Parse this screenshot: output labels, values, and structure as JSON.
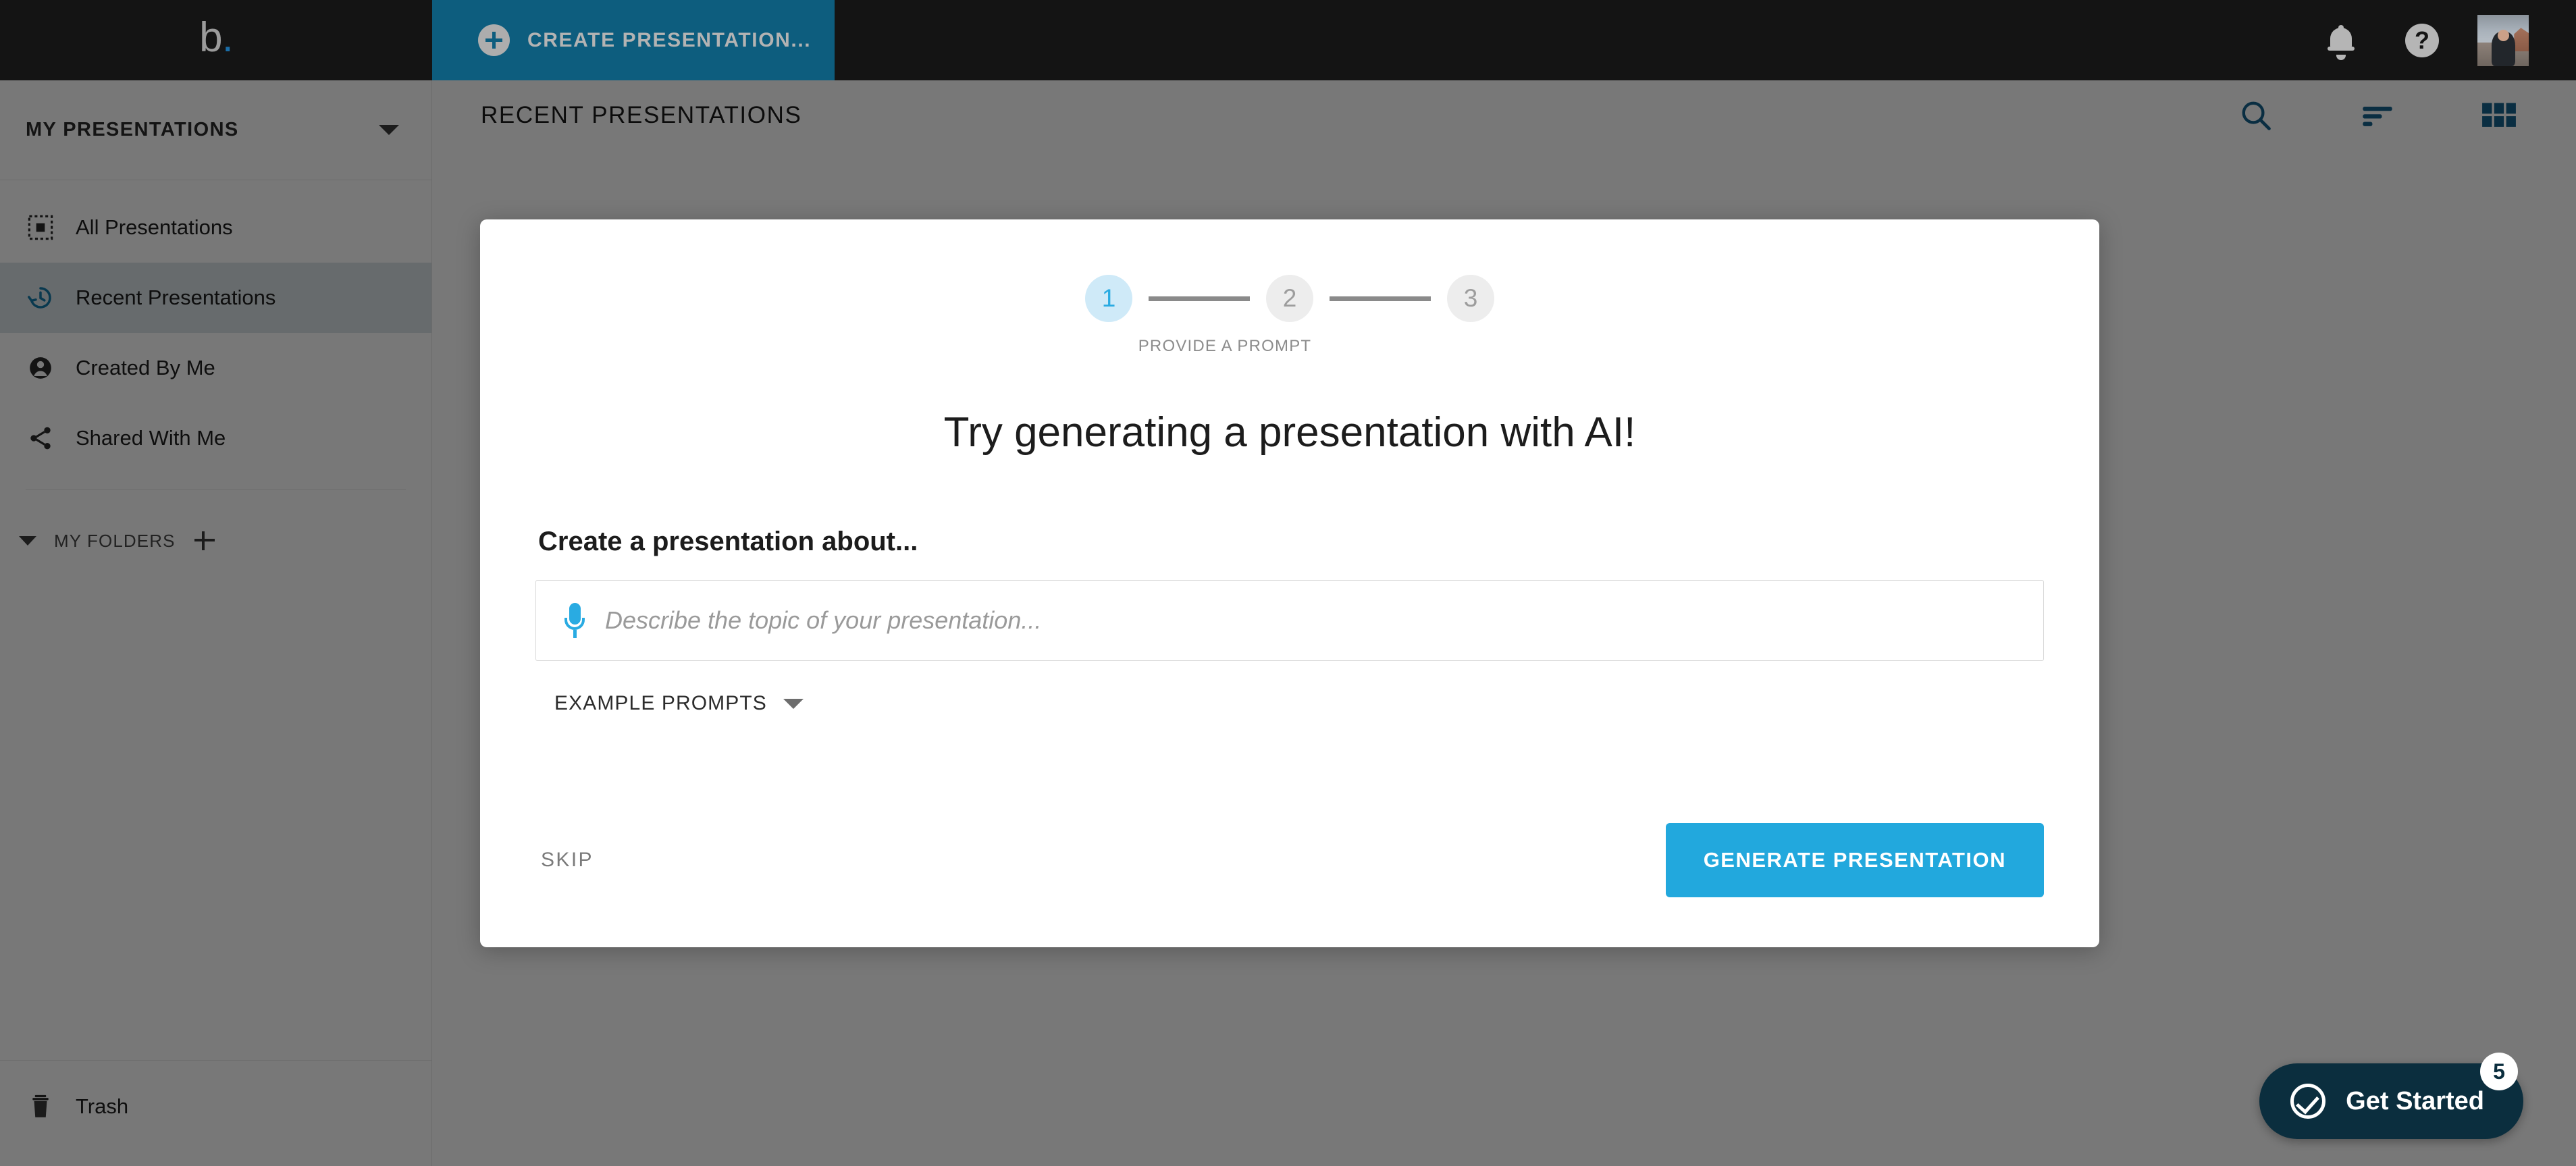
{
  "app": {
    "logo_text": "b",
    "logo_dot": "."
  },
  "topbar": {
    "create_button_label": "CREATE PRESENTATION...",
    "create_icon": "plus-circle-icon",
    "notifications_icon": "bell-icon",
    "help_icon": "help-circle-icon",
    "help_glyph": "?",
    "avatar_icon": "user-avatar"
  },
  "sidebar": {
    "header_title": "MY PRESENTATIONS",
    "header_caret_icon": "chevron-down-icon",
    "items": [
      {
        "label": "All Presentations",
        "icon": "dashed-square-icon",
        "active": false
      },
      {
        "label": "Recent Presentations",
        "icon": "history-clock-icon",
        "active": true
      },
      {
        "label": "Created By Me",
        "icon": "account-circle-icon",
        "active": false
      },
      {
        "label": "Shared With Me",
        "icon": "share-icon",
        "active": false
      }
    ],
    "folders": {
      "label": "MY FOLDERS",
      "caret_icon": "chevron-down-icon",
      "add_icon": "plus-icon"
    },
    "trash": {
      "label": "Trash",
      "icon": "trash-icon"
    }
  },
  "main": {
    "title": "RECENT PRESENTATIONS",
    "tools": [
      {
        "name": "search-icon"
      },
      {
        "name": "sort-icon"
      },
      {
        "name": "grid-view-icon"
      }
    ]
  },
  "modal": {
    "steps": [
      {
        "number": "1",
        "active": true
      },
      {
        "number": "2",
        "active": false
      },
      {
        "number": "3",
        "active": false
      }
    ],
    "step_caption": "PROVIDE A PROMPT",
    "title": "Try generating a presentation with AI!",
    "field_label": "Create a presentation about...",
    "prompt_value": "",
    "prompt_placeholder": "Describe the topic of your presentation...",
    "mic_icon": "microphone-icon",
    "example_prompts_label": "EXAMPLE PROMPTS",
    "example_caret_icon": "chevron-down-icon",
    "skip_label": "SKIP",
    "generate_label": "GENERATE PRESENTATION"
  },
  "get_started": {
    "label": "Get Started",
    "icon": "check-circle-icon",
    "badge_count": "5"
  },
  "colors": {
    "accent_blue": "#29abe2",
    "teal_dark": "#0d5d7e",
    "tool_blue": "#16638c",
    "topbar_dark": "#141414",
    "navy": "#0b2e3e"
  }
}
